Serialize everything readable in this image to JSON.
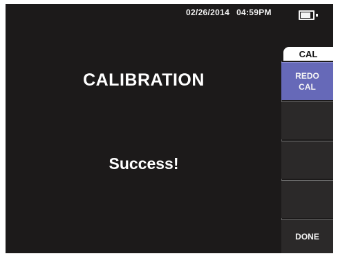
{
  "status_bar": {
    "date": "02/26/2014",
    "time": "04:59PM",
    "battery_level": 0.8,
    "battery_icon": "battery-icon"
  },
  "main": {
    "title": "CALIBRATION",
    "message": "Success!"
  },
  "menu": {
    "title": "CAL",
    "keys": [
      {
        "label": "REDO\nCAL",
        "active": true
      },
      {
        "label": ""
      },
      {
        "label": ""
      },
      {
        "label": ""
      },
      {
        "label": "DONE"
      }
    ]
  },
  "colors": {
    "background": "#1c1a1a",
    "active_key": "#6669b8",
    "text": "#ffffff"
  }
}
